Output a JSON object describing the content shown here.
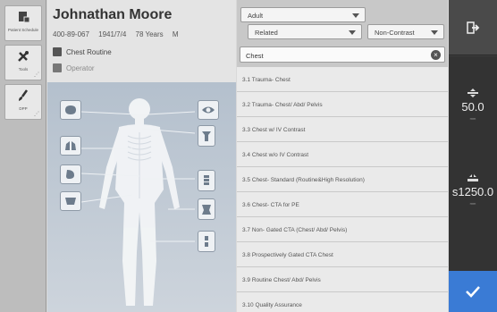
{
  "nav": [
    {
      "label": "Patient Schedule",
      "icon": "calendar-icon"
    },
    {
      "label": "Tools",
      "icon": "tools-icon"
    },
    {
      "label": "DPP",
      "icon": "brush-icon"
    }
  ],
  "patient": {
    "name": "Johnathan Moore",
    "id": "400-89-067",
    "dob": "1941/7/4",
    "age": "78 Years",
    "sex": "M",
    "protocol": "Chest Routine",
    "operator": "Operator"
  },
  "filters": {
    "age_group": "Adult",
    "relation": "Related",
    "contrast": "Non-Contrast",
    "search_value": "Chest"
  },
  "protocols": [
    "3.1 Trauma- Chest",
    "3.2 Trauma- Chest/ Abd/ Pelvis",
    "3.3 Chest w/ IV Contrast",
    "3.4 Chest w/o IV Contrast",
    "3.5 Chest- Standard (Routine&High Resolution)",
    "3.6 Chest- CTA for PE",
    "3.7 Non- Gated CTA  (Chest/ Abd/ Pelvis)",
    "3.8 Prospectively Gated CTA Chest",
    "3.9 Routine Chest/ Abd/ Pelvis",
    "3.10 Quality Assurance"
  ],
  "right": {
    "value1": "50.0",
    "unit1": "mm",
    "value2": "s1250.0",
    "unit2": "mm"
  }
}
